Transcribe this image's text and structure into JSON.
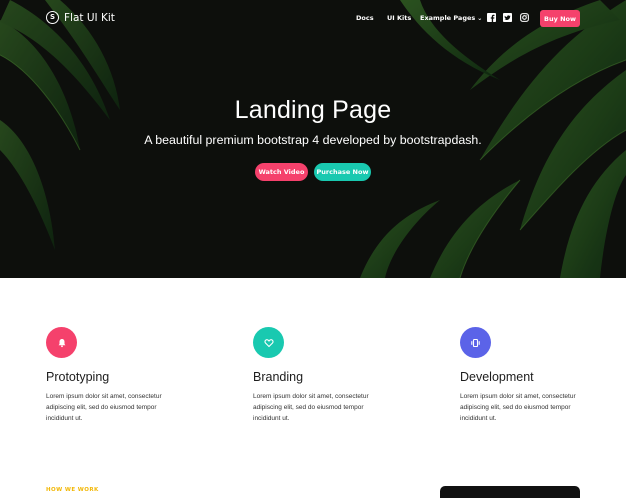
{
  "brand": {
    "name": "Flat UI Kit",
    "logo_letter": "S"
  },
  "nav": {
    "links": [
      "Docs",
      "UI Kits",
      "Example Pages"
    ],
    "dropdown_chevron": "⌄",
    "social_icons": [
      "facebook-icon",
      "twitter-icon",
      "instagram-icon"
    ],
    "buy_label": "Buy Now"
  },
  "hero": {
    "title": "Landing Page",
    "subtitle": "A beautiful premium bootstrap 4 developed by bootstrapdash.",
    "watch_label": "Watch Video",
    "purchase_label": "Purchase Now"
  },
  "features": [
    {
      "title": "Prototyping",
      "icon": "bell-icon",
      "color": "#f5416c",
      "text": "Lorem ipsum dolor sit amet, consectetur adipiscing elit, sed do eiusmod tempor incididunt ut."
    },
    {
      "title": "Branding",
      "icon": "heart-icon",
      "color": "#19c9b0",
      "text": "Lorem ipsum dolor sit amet, consectetur adipiscing elit, sed do eiusmod tempor incididunt ut."
    },
    {
      "title": "Development",
      "icon": "vibrate-icon",
      "color": "#5b63e8",
      "text": "Lorem ipsum dolor sit amet, consectetur adipiscing elit, sed do eiusmod tempor incididunt ut."
    }
  ],
  "how_we_work": "HOW WE WORK",
  "colors": {
    "accent_pink": "#f5416c",
    "accent_teal": "#19c9b0",
    "accent_indigo": "#5b63e8",
    "label_yellow": "#f2b705"
  }
}
